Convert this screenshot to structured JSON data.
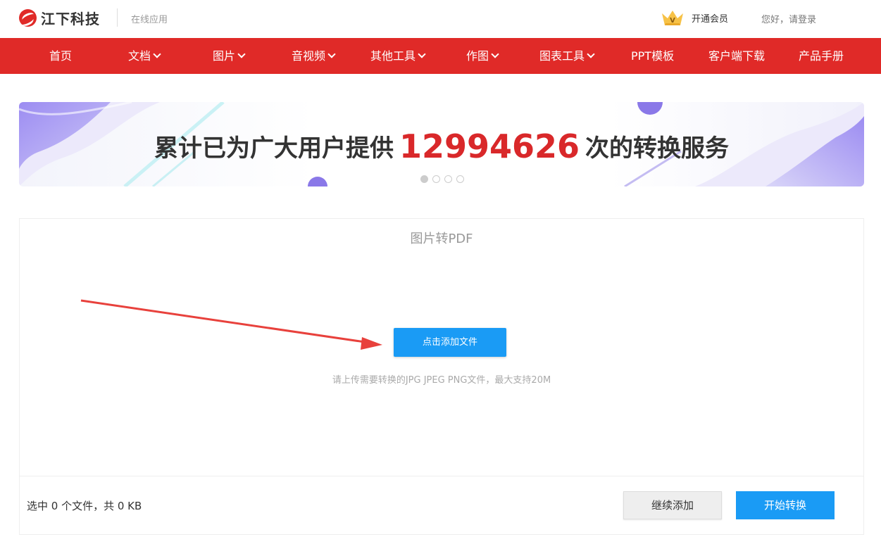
{
  "header": {
    "brand": "江下科技",
    "subtitle": "在线应用",
    "vip_label": "开通会员",
    "login_label": "您好，请登录"
  },
  "nav": {
    "items": [
      {
        "label": "首页",
        "dropdown": false
      },
      {
        "label": "文档",
        "dropdown": true
      },
      {
        "label": "图片",
        "dropdown": true
      },
      {
        "label": "音视频",
        "dropdown": true
      },
      {
        "label": "其他工具",
        "dropdown": true
      },
      {
        "label": "作图",
        "dropdown": true
      },
      {
        "label": "图表工具",
        "dropdown": true
      },
      {
        "label": "PPT模板",
        "dropdown": false
      },
      {
        "label": "客户端下载",
        "dropdown": false
      },
      {
        "label": "产品手册",
        "dropdown": false
      }
    ]
  },
  "banner": {
    "text_before": "累计已为广大用户提供",
    "count": "12994626",
    "text_after": "次的转换服务",
    "slides": 4,
    "active_slide": 1
  },
  "upload": {
    "title": "图片转PDF",
    "add_button": "点击添加文件",
    "hint": "请上传需要转换的JPG JPEG PNG文件，最大支持20M",
    "status": "选中 0 个文件，共 0 KB",
    "continue_button": "继续添加",
    "start_button": "开始转换"
  },
  "colors": {
    "brand_red": "#e02a28",
    "primary_blue": "#1a9bf5",
    "arrow_red": "#e8413c"
  }
}
